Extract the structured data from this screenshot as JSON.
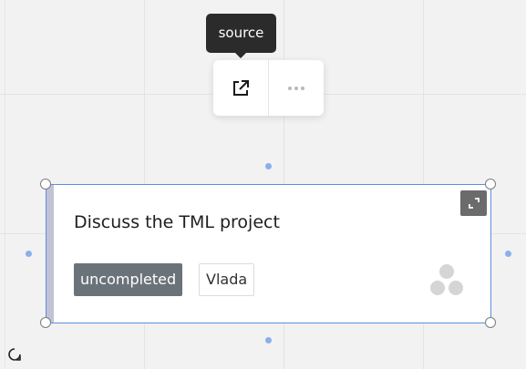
{
  "tooltip": {
    "text": "source"
  },
  "toolbar": {
    "items": [
      {
        "icon": "external-link-icon"
      },
      {
        "icon": "more-horizontal-icon"
      }
    ]
  },
  "card": {
    "title": "Discuss the TML project",
    "status_tag": "uncompleted",
    "assignee_tag": "Vlada",
    "accent_color": "#5b8fe0",
    "stripe_color": "#c2c2d6",
    "status_color": "#6b737a"
  }
}
